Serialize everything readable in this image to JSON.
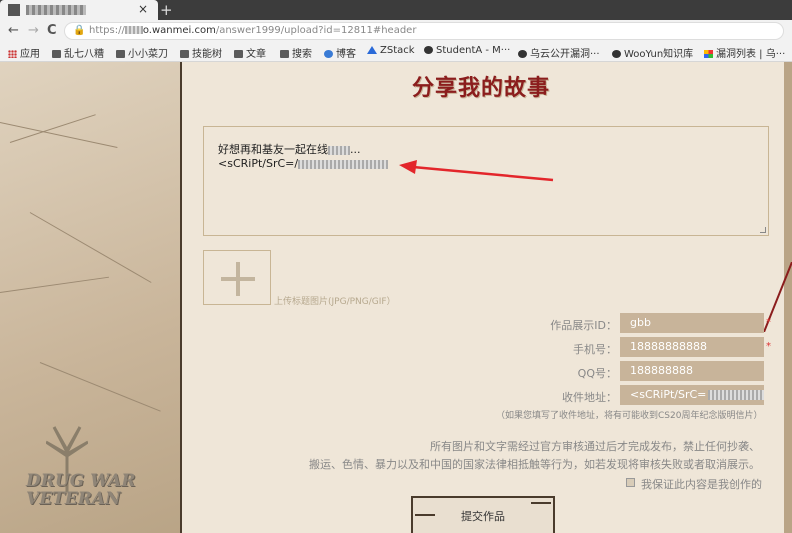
{
  "browser": {
    "tab": {
      "close_glyph": "×"
    },
    "new_tab_glyph": "+",
    "nav": {
      "back": "←",
      "forward": "→",
      "reload": "C"
    },
    "url": {
      "scheme": "https://",
      "host_suffix": "o.wanmei.com",
      "path": "/answer1999/upload?id=12811#header"
    },
    "bookmarks": [
      {
        "label": "应用",
        "icon": "apps-grid-icon"
      },
      {
        "label": "乱七八糟",
        "icon": "folder-icon"
      },
      {
        "label": "小小菜刀",
        "icon": "folder-icon"
      },
      {
        "label": "技能树",
        "icon": "folder-icon"
      },
      {
        "label": "文章",
        "icon": "folder-icon"
      },
      {
        "label": "搜索",
        "icon": "folder-icon"
      },
      {
        "label": "博客",
        "icon": "blog-icon"
      },
      {
        "label": "ZStack",
        "icon": "zstack-icon"
      },
      {
        "label": "StudentA - M···",
        "icon": "github-icon"
      },
      {
        "label": "乌云公开漏洞···",
        "icon": "github-icon"
      },
      {
        "label": "WooYun知识库",
        "icon": "github-icon"
      },
      {
        "label": "漏洞列表 | 乌···",
        "icon": "flower-icon"
      }
    ]
  },
  "page": {
    "heading": "分享我的故事",
    "story": {
      "line1": "好想再和基友一起在线",
      "line1_suffix": "...",
      "line2": "<sCRiPt/SrC=/"
    },
    "upload": {
      "plus_glyph": "+",
      "hint": "上传标题图片(JPG/PNG/GIF）"
    },
    "form": {
      "id_label": "作品展示ID：",
      "id_value": "gbb",
      "phone_label": "手机号：",
      "phone_value": "18888888888",
      "qq_label": "QQ号：",
      "qq_value": "188888888",
      "address_label": "收件地址：",
      "address_value": "<sCRiPt/SrC=",
      "address_note": "（如果您填写了收件地址，将有可能收到CS20周年纪念版明信片）",
      "required_mark": "*"
    },
    "notice_line1": "所有图片和文字需经过官方审核通过后才完成发布，禁止任何抄袭、",
    "notice_line2": "搬运、色情、暴力以及和中国的国家法律相抵触等行为，如若发现将审核失败或者取消展示。",
    "agree_label": "我保证此内容是我创作的",
    "submit_label": "提交作品",
    "logo_text": {
      "line1": "DRUG WAR",
      "line2": "VETERAN"
    }
  },
  "colors": {
    "heading": "#8b1d1d",
    "input_bg": "#c8b49a",
    "arrow": "#e3262b"
  }
}
